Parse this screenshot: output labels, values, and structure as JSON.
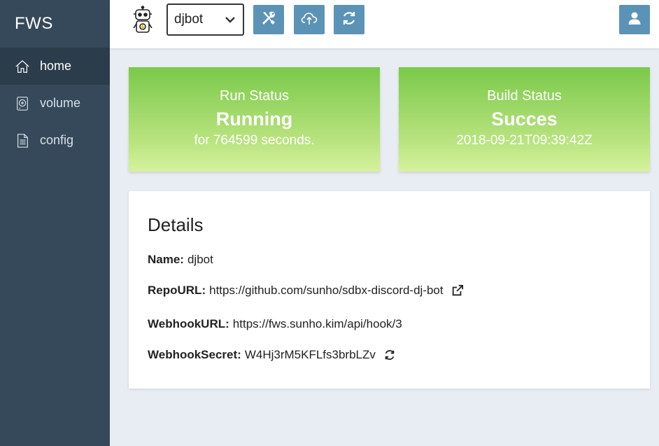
{
  "app": {
    "brand": "FWS"
  },
  "sidebar": {
    "items": [
      {
        "label": "home",
        "icon": "home-icon",
        "active": true
      },
      {
        "label": "volume",
        "icon": "hdd-icon",
        "active": false
      },
      {
        "label": "config",
        "icon": "file-icon",
        "active": false
      }
    ]
  },
  "topbar": {
    "robot_icon": "robot-icon",
    "project_select": {
      "selected": "djbot"
    },
    "buttons": [
      {
        "icon": "tools-icon"
      },
      {
        "icon": "cloud-upload-icon"
      },
      {
        "icon": "refresh-icon"
      },
      {
        "icon": "user-icon"
      }
    ]
  },
  "status": {
    "run": {
      "title": "Run Status",
      "value": "Running",
      "sub": "for 764599 seconds."
    },
    "build": {
      "title": "Build Status",
      "value": "Succes",
      "sub": "2018-09-21T09:39:42Z"
    }
  },
  "details": {
    "heading": "Details",
    "name_label": "Name:",
    "name_value": "djbot",
    "repo_label": "RepoURL:",
    "repo_value": "https://github.com/sunho/sdbx-discord-dj-bot",
    "hook_label": "WebhookURL:",
    "hook_value": "https://fws.sunho.kim/api/hook/3",
    "secret_label": "WebhookSecret:",
    "secret_value": "W4Hj3rM5KFLfs3brbLZv"
  },
  "colors": {
    "sidebar_bg": "#35495a",
    "sidebar_active": "#2b3c4b",
    "button_blue": "#5b93b6",
    "status_green_top": "#7ac94a",
    "status_green_bottom": "#d6f29c",
    "page_bg": "#e8ecf3"
  }
}
